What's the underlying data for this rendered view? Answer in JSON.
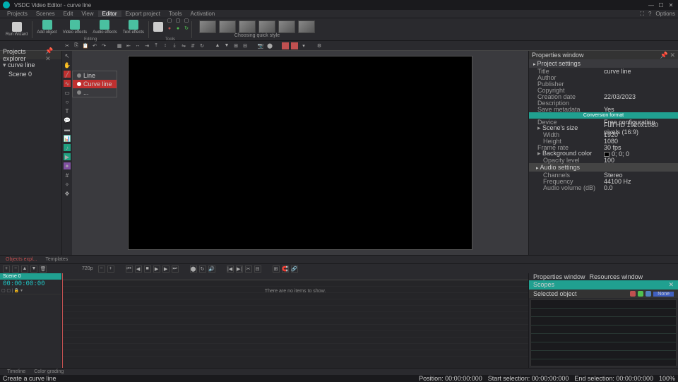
{
  "app": {
    "title": "VSDC Video Editor - curve line"
  },
  "window": {
    "min": "—",
    "max": "☐",
    "close": "✕",
    "pin": "⤡"
  },
  "menu": {
    "items": [
      "Projects",
      "Scenes",
      "Edit",
      "View",
      "Editor",
      "Export project",
      "Tools",
      "Activation"
    ],
    "active": 4,
    "options": "Options"
  },
  "ribbon": {
    "buttons": [
      {
        "label": "Run\nWizard",
        "icon": "pen"
      },
      {
        "label": "Add\nobject",
        "icon": "teal"
      },
      {
        "label": "Video\neffects",
        "icon": "teal"
      },
      {
        "label": "Audio\neffects",
        "icon": "teal"
      },
      {
        "label": "Text\neffects",
        "icon": "teal"
      }
    ],
    "groupLabel": "Editing",
    "toolsLabel": "Tools",
    "quickStyle": "Choosing quick style"
  },
  "projects": {
    "title": "Projects explorer",
    "root": "curve line",
    "child": "Scene 0"
  },
  "shapeMenu": {
    "items": [
      "Line",
      "Curve line",
      "..."
    ],
    "selected": 1
  },
  "properties": {
    "title": "Properties window",
    "section": "Project settings",
    "rows": [
      {
        "k": "Title",
        "v": "curve line"
      },
      {
        "k": "Author",
        "v": ""
      },
      {
        "k": "Publisher",
        "v": ""
      },
      {
        "k": "Copyright",
        "v": ""
      },
      {
        "k": "Creation date",
        "v": "22/03/2023"
      },
      {
        "k": "Description",
        "v": ""
      },
      {
        "k": "Save metadata",
        "v": "Yes"
      }
    ],
    "convHeader": "Conversion format",
    "device": {
      "k": "Device",
      "v": "Free configuration"
    },
    "sceneSize": {
      "k": "Scene's size",
      "v": "Full HD 1920x1080 pixels (16:9)"
    },
    "width": {
      "k": "Width",
      "v": "1920"
    },
    "height": {
      "k": "Height",
      "v": "1080"
    },
    "framerate": {
      "k": "Frame rate",
      "v": "30 fps"
    },
    "bgcolor": {
      "k": "Background color",
      "v": "0; 0; 0"
    },
    "opacity": {
      "k": "Opacity level",
      "v": "100"
    },
    "audioHeader": "Audio settings",
    "channels": {
      "k": "Channels",
      "v": "Stereo"
    },
    "frequency": {
      "k": "Frequency",
      "v": "44100 Hz"
    },
    "volume": {
      "k": "Audio volume (dB)",
      "v": "0.0"
    }
  },
  "tabs": {
    "objects": "Objects expl...",
    "templates": "Templates",
    "props": "Properties window",
    "resources": "Resources window"
  },
  "transport": {
    "res": "720p",
    "zoom": "—"
  },
  "timeline": {
    "scene": "Scene 0",
    "timecode": "00:00:00:00",
    "empty": "There are no items to show."
  },
  "scopes": {
    "title": "Scopes",
    "selected": "Selected object",
    "none": "None",
    "close": "✕"
  },
  "bottomTabs": [
    "Timeline",
    "Color grading"
  ],
  "status": {
    "hint": "Create a curve line",
    "pos": "Position:",
    "posv": "00:00:00:000",
    "start": "Start selection:",
    "startv": "00:00:00:000",
    "end": "End selection:",
    "endv": "00:00:00:000",
    "zoom": "100%"
  }
}
